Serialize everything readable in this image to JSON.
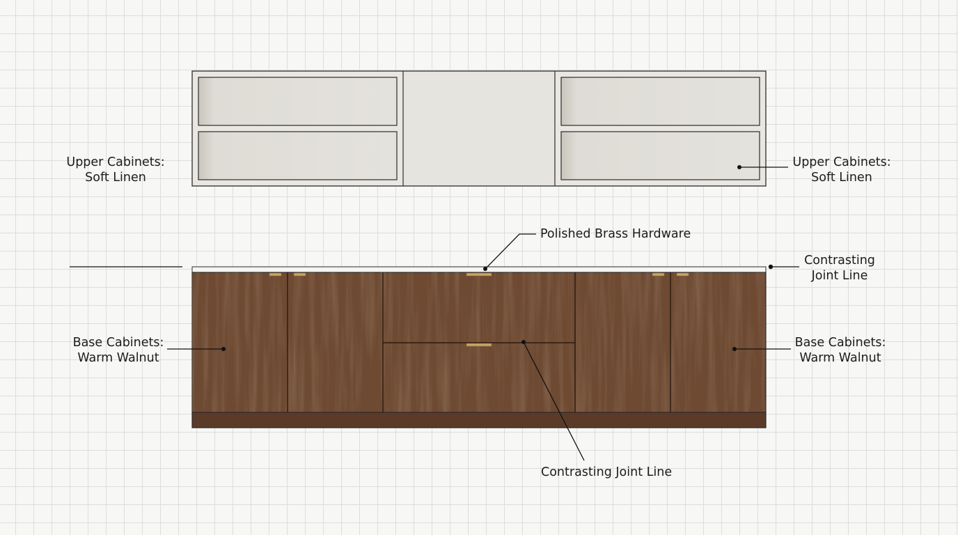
{
  "labels": {
    "upper_left": {
      "line1": "Upper Cabinets:",
      "line2": "Soft Linen"
    },
    "upper_right": {
      "line1": "Upper Cabinets:",
      "line2": "Soft Linen"
    },
    "hardware": "Polished Brass Hardware",
    "joint_right": {
      "line1": "Contrasting",
      "line2": "Joint Line"
    },
    "base_left": {
      "line1": "Base Cabinets:",
      "line2": "Warm Walnut"
    },
    "base_right": {
      "line1": "Base Cabinets:",
      "line2": "Warm Walnut"
    },
    "joint_bottom": "Contrasting Joint Line"
  },
  "colors": {
    "linen": "#e9e7e1",
    "linen_inner": "#dcdad3",
    "walnut": "#6e4a33",
    "walnut_dark": "#4f3322",
    "toe_kick": "#5b3b28",
    "brass": "#c9a464",
    "countertop": "#f6f5f1",
    "outline": "#2b2b2b"
  }
}
